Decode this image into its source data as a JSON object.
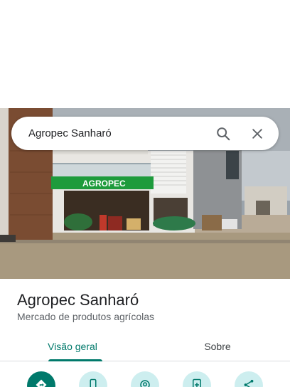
{
  "search": {
    "query": "Agropec Sanharó",
    "search_icon": "search-icon",
    "close_icon": "close-icon"
  },
  "photo": {
    "sign_text": "AGROPEC",
    "description_icon": "storefront-photo"
  },
  "place": {
    "name": "Agropec Sanharó",
    "category": "Mercado de produtos agrícolas"
  },
  "tabs": [
    {
      "label": "Visão geral",
      "active": true
    },
    {
      "label": "Sobre",
      "active": false
    }
  ],
  "actions": [
    {
      "icon": "directions-icon"
    },
    {
      "icon": "phone-icon"
    },
    {
      "icon": "location-icon"
    },
    {
      "icon": "add-photo-icon"
    },
    {
      "icon": "share-icon"
    }
  ],
  "colors": {
    "accent": "#00796b",
    "action_bg": "#cdeeef",
    "sign_green": "#1e9b3c"
  }
}
